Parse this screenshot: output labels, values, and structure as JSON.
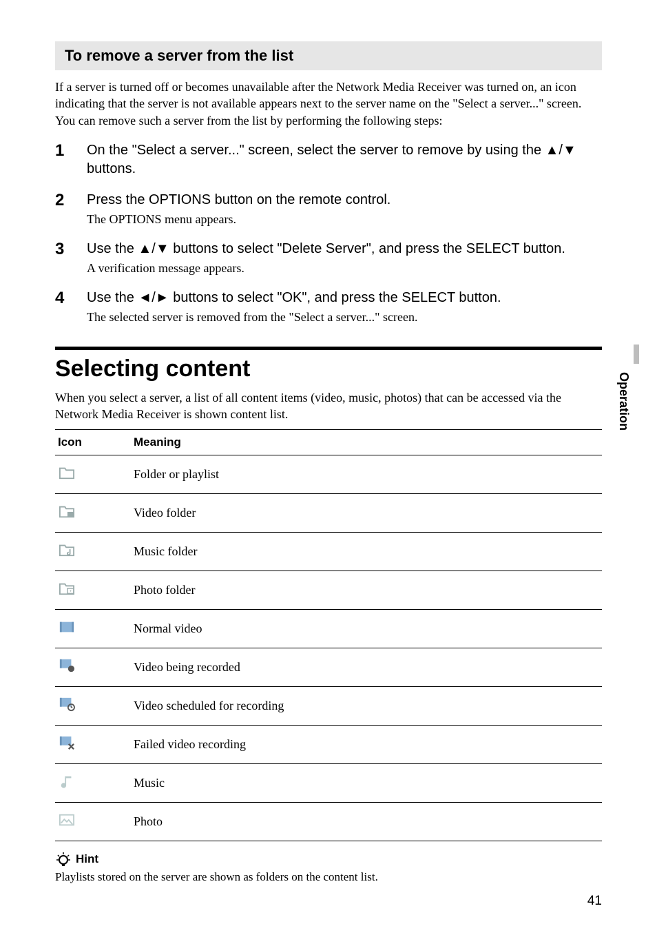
{
  "section_bar": "To remove a server from the list",
  "intro": "If a server is turned off or becomes unavailable after the Network Media Receiver was turned on, an icon indicating that the server is not available appears next to the server name on the \"Select a server...\" screen. You can remove such a server from the list by performing the following steps:",
  "steps": [
    {
      "num": "1",
      "main_a": "On the \"Select a server...\" screen, select the server to remove by using the ",
      "main_arrows": "▲/▼",
      "main_b": " buttons.",
      "sub": ""
    },
    {
      "num": "2",
      "main_a": "Press the OPTIONS button on the remote control.",
      "main_arrows": "",
      "main_b": "",
      "sub": "The OPTIONS menu appears."
    },
    {
      "num": "3",
      "main_a": "Use the ",
      "main_arrows": "▲/▼",
      "main_b": "  buttons to select \"Delete Server\", and press the SELECT button.",
      "sub": "A verification message appears."
    },
    {
      "num": "4",
      "main_a": "Use the ",
      "main_arrows": "◄/►",
      "main_b": " buttons to select \"OK\", and press the SELECT button.",
      "sub": "The selected server is removed from the \"Select a server...\" screen."
    }
  ],
  "heading": "Selecting content",
  "sub_intro": "When you select a server, a list of all content items (video, music, photos) that can be accessed via the Network Media Receiver is shown content list.",
  "table": {
    "col_icon": "Icon",
    "col_meaning": "Meaning",
    "rows": [
      {
        "icon": "folder",
        "meaning": "Folder or playlist"
      },
      {
        "icon": "video-folder",
        "meaning": "Video folder"
      },
      {
        "icon": "music-folder",
        "meaning": "Music folder"
      },
      {
        "icon": "photo-folder",
        "meaning": "Photo folder"
      },
      {
        "icon": "normal-video",
        "meaning": "Normal video"
      },
      {
        "icon": "video-recording",
        "meaning": "Video being recorded"
      },
      {
        "icon": "video-scheduled",
        "meaning": "Video scheduled for recording"
      },
      {
        "icon": "video-failed",
        "meaning": "Failed video recording"
      },
      {
        "icon": "music",
        "meaning": "Music"
      },
      {
        "icon": "photo",
        "meaning": "Photo"
      }
    ]
  },
  "hint_label": "Hint",
  "hint_body": "Playlists stored on the server are shown as folders on the content list.",
  "side_tab": "Operation",
  "page_num": "41"
}
